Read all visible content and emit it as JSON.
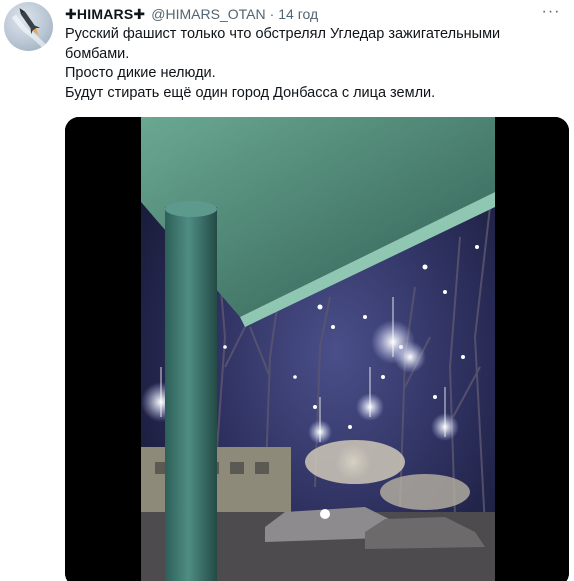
{
  "tweet": {
    "display_name": "✚HIMARS✚",
    "handle": "@HIMARS_OTAN",
    "separator": "·",
    "time": "14 год",
    "more_label": "···",
    "lines": [
      "Русский фашист только что обстрелял Угледар зажигательными бомбами.",
      "Просто дикие нелюди.",
      "Будут стирать ещё один город Донбасса с лица земли."
    ]
  },
  "avatar": {
    "icon": "missile-icon"
  },
  "media": {
    "type": "video-frame"
  }
}
